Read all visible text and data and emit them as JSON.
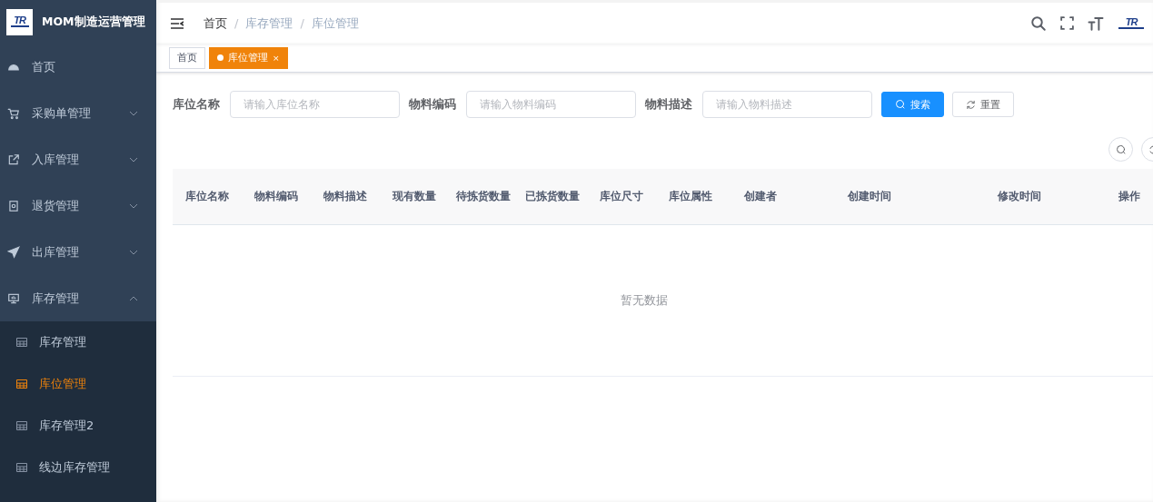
{
  "app": {
    "logo_text": "TR",
    "title": "MOM制造运营管理"
  },
  "sidebar": {
    "items": [
      {
        "label": "首页",
        "kind": "link"
      },
      {
        "label": "采购单管理",
        "kind": "group",
        "expanded": false
      },
      {
        "label": "入库管理",
        "kind": "group",
        "expanded": false
      },
      {
        "label": "退货管理",
        "kind": "group",
        "expanded": false
      },
      {
        "label": "出库管理",
        "kind": "group",
        "expanded": false
      },
      {
        "label": "库存管理",
        "kind": "group",
        "expanded": true,
        "children": [
          {
            "label": "库存管理",
            "selected": false
          },
          {
            "label": "库位管理",
            "selected": true
          },
          {
            "label": "库存管理2",
            "selected": false
          },
          {
            "label": "线边库存管理",
            "selected": false
          }
        ]
      }
    ]
  },
  "breadcrumb": [
    "首页",
    "库存管理",
    "库位管理"
  ],
  "breadcrumb_separator": "/",
  "header_logo_text": "TR",
  "tags": [
    {
      "label": "首页",
      "selected": false
    },
    {
      "label": "库位管理",
      "selected": true,
      "close": "×"
    }
  ],
  "filters": [
    {
      "label": "库位名称",
      "placeholder": "请输入库位名称"
    },
    {
      "label": "物料编码",
      "placeholder": "请输入物料编码"
    },
    {
      "label": "物料描述",
      "placeholder": "请输入物料描述"
    }
  ],
  "buttons": [
    {
      "kind": "primary",
      "label": "搜索"
    },
    {
      "kind": "default",
      "label": "重置"
    }
  ],
  "table": {
    "columns": [
      "库位名称",
      "物料编码",
      "物料描述",
      "现有数量",
      "待拣货数量",
      "已拣货数量",
      "库位尺寸",
      "库位属性",
      "创建者",
      "创建时间",
      "修改时间",
      "操作"
    ],
    "empty_text": "暂无数据"
  }
}
